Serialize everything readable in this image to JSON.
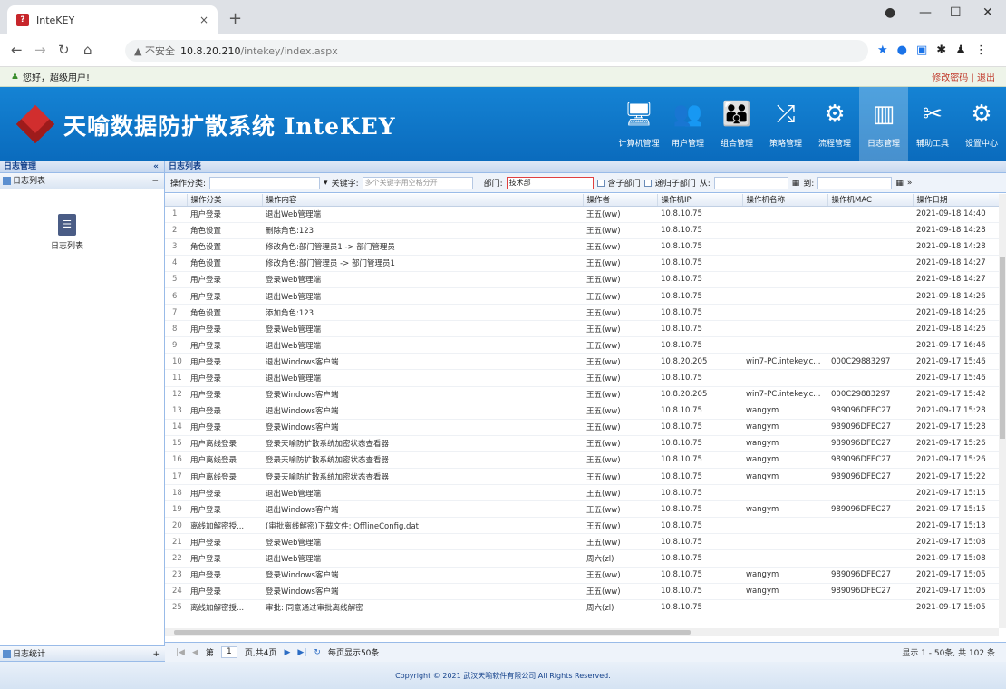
{
  "browser": {
    "tab_title": "InteKEY",
    "close": "×",
    "new_tab": "+",
    "url_warning": "▲ 不安全",
    "url_host": "10.8.20.210",
    "url_path": "/intekey/index.aspx"
  },
  "info": {
    "greeting": "您好，超级用户!",
    "links": "修改密码 | 退出"
  },
  "header": {
    "brand": "天喻数据防扩散系统 InteKEY",
    "modules": [
      {
        "icon": "🖥",
        "label": "计算机管理"
      },
      {
        "icon": "👥",
        "label": "用户管理"
      },
      {
        "icon": "👪",
        "label": "组合管理"
      },
      {
        "icon": "⤮",
        "label": "策略管理"
      },
      {
        "icon": "⚙",
        "label": "流程管理"
      },
      {
        "icon": "▥",
        "label": "日志管理"
      },
      {
        "icon": "✂",
        "label": "辅助工具"
      },
      {
        "icon": "⚙",
        "label": "设置中心"
      }
    ]
  },
  "sidebar": {
    "title": "日志管理",
    "section": "日志列表",
    "item": "日志列表",
    "bottom": "日志统计"
  },
  "main": {
    "title": "日志列表"
  },
  "filters": {
    "category_label": "操作分类:",
    "keyword_label": "关键字:",
    "keyword_placeholder": "多个关键字用空格分开",
    "dept_label": "部门:",
    "dept_value": "技术部",
    "opt1": "含子部门",
    "opt2": "递归子部门",
    "from_label": "从:",
    "to_label": "到:"
  },
  "columns": [
    "",
    "操作分类",
    "操作内容",
    "操作者",
    "操作机IP",
    "操作机名称",
    "操作机MAC",
    "操作日期"
  ],
  "rows": [
    [
      "1",
      "用户登录",
      "退出Web管理端",
      "王五(ww)",
      "10.8.10.75",
      "",
      "",
      "2021-09-18 14:40"
    ],
    [
      "2",
      "角色设置",
      "删除角色:123",
      "王五(ww)",
      "10.8.10.75",
      "",
      "",
      "2021-09-18 14:28"
    ],
    [
      "3",
      "角色设置",
      "修改角色:部门管理员1 -> 部门管理员",
      "王五(ww)",
      "10.8.10.75",
      "",
      "",
      "2021-09-18 14:28"
    ],
    [
      "4",
      "角色设置",
      "修改角色:部门管理员 -> 部门管理员1",
      "王五(ww)",
      "10.8.10.75",
      "",
      "",
      "2021-09-18 14:27"
    ],
    [
      "5",
      "用户登录",
      "登录Web管理端",
      "王五(ww)",
      "10.8.10.75",
      "",
      "",
      "2021-09-18 14:27"
    ],
    [
      "6",
      "用户登录",
      "退出Web管理端",
      "王五(ww)",
      "10.8.10.75",
      "",
      "",
      "2021-09-18 14:26"
    ],
    [
      "7",
      "角色设置",
      "添加角色:123",
      "王五(ww)",
      "10.8.10.75",
      "",
      "",
      "2021-09-18 14:26"
    ],
    [
      "8",
      "用户登录",
      "登录Web管理端",
      "王五(ww)",
      "10.8.10.75",
      "",
      "",
      "2021-09-18 14:26"
    ],
    [
      "9",
      "用户登录",
      "退出Web管理端",
      "王五(ww)",
      "10.8.10.75",
      "",
      "",
      "2021-09-17 16:46"
    ],
    [
      "10",
      "用户登录",
      "退出Windows客户端",
      "王五(ww)",
      "10.8.20.205",
      "win7-PC.intekey.c...",
      "000C29883297",
      "2021-09-17 15:46"
    ],
    [
      "11",
      "用户登录",
      "退出Web管理端",
      "王五(ww)",
      "10.8.10.75",
      "",
      "",
      "2021-09-17 15:46"
    ],
    [
      "12",
      "用户登录",
      "登录Windows客户端",
      "王五(ww)",
      "10.8.20.205",
      "win7-PC.intekey.c...",
      "000C29883297",
      "2021-09-17 15:42"
    ],
    [
      "13",
      "用户登录",
      "退出Windows客户端",
      "王五(ww)",
      "10.8.10.75",
      "wangym",
      "989096DFEC27",
      "2021-09-17 15:28"
    ],
    [
      "14",
      "用户登录",
      "登录Windows客户端",
      "王五(ww)",
      "10.8.10.75",
      "wangym",
      "989096DFEC27",
      "2021-09-17 15:28"
    ],
    [
      "15",
      "用户离线登录",
      "登录天喻防扩散系统加密状态查看器",
      "王五(ww)",
      "10.8.10.75",
      "wangym",
      "989096DFEC27",
      "2021-09-17 15:26"
    ],
    [
      "16",
      "用户离线登录",
      "登录天喻防扩散系统加密状态查看器",
      "王五(ww)",
      "10.8.10.75",
      "wangym",
      "989096DFEC27",
      "2021-09-17 15:26"
    ],
    [
      "17",
      "用户离线登录",
      "登录天喻防扩散系统加密状态查看器",
      "王五(ww)",
      "10.8.10.75",
      "wangym",
      "989096DFEC27",
      "2021-09-17 15:22"
    ],
    [
      "18",
      "用户登录",
      "退出Web管理端",
      "王五(ww)",
      "10.8.10.75",
      "",
      "",
      "2021-09-17 15:15"
    ],
    [
      "19",
      "用户登录",
      "退出Windows客户端",
      "王五(ww)",
      "10.8.10.75",
      "wangym",
      "989096DFEC27",
      "2021-09-17 15:15"
    ],
    [
      "20",
      "离线加解密授...",
      "(审批离线解密)下载文件: OfflineConfig.dat",
      "王五(ww)",
      "10.8.10.75",
      "",
      "",
      "2021-09-17 15:13"
    ],
    [
      "21",
      "用户登录",
      "登录Web管理端",
      "王五(ww)",
      "10.8.10.75",
      "",
      "",
      "2021-09-17 15:08"
    ],
    [
      "22",
      "用户登录",
      "退出Web管理端",
      "周六(zl)",
      "10.8.10.75",
      "",
      "",
      "2021-09-17 15:08"
    ],
    [
      "23",
      "用户登录",
      "登录Windows客户端",
      "王五(ww)",
      "10.8.10.75",
      "wangym",
      "989096DFEC27",
      "2021-09-17 15:05"
    ],
    [
      "24",
      "用户登录",
      "登录Windows客户端",
      "王五(ww)",
      "10.8.10.75",
      "wangym",
      "989096DFEC27",
      "2021-09-17 15:05"
    ],
    [
      "25",
      "离线加解密授...",
      "审批: 同意通过审批离线解密",
      "周六(zl)",
      "10.8.10.75",
      "",
      "",
      "2021-09-17 15:05"
    ]
  ],
  "pager": {
    "page": "1",
    "total": "页,共4页",
    "auto": "每页显示50条",
    "summary": "显示 1 - 50条, 共 102 条"
  },
  "footer": "Copyright © 2021 武汉天喻软件有限公司 All Rights Reserved."
}
